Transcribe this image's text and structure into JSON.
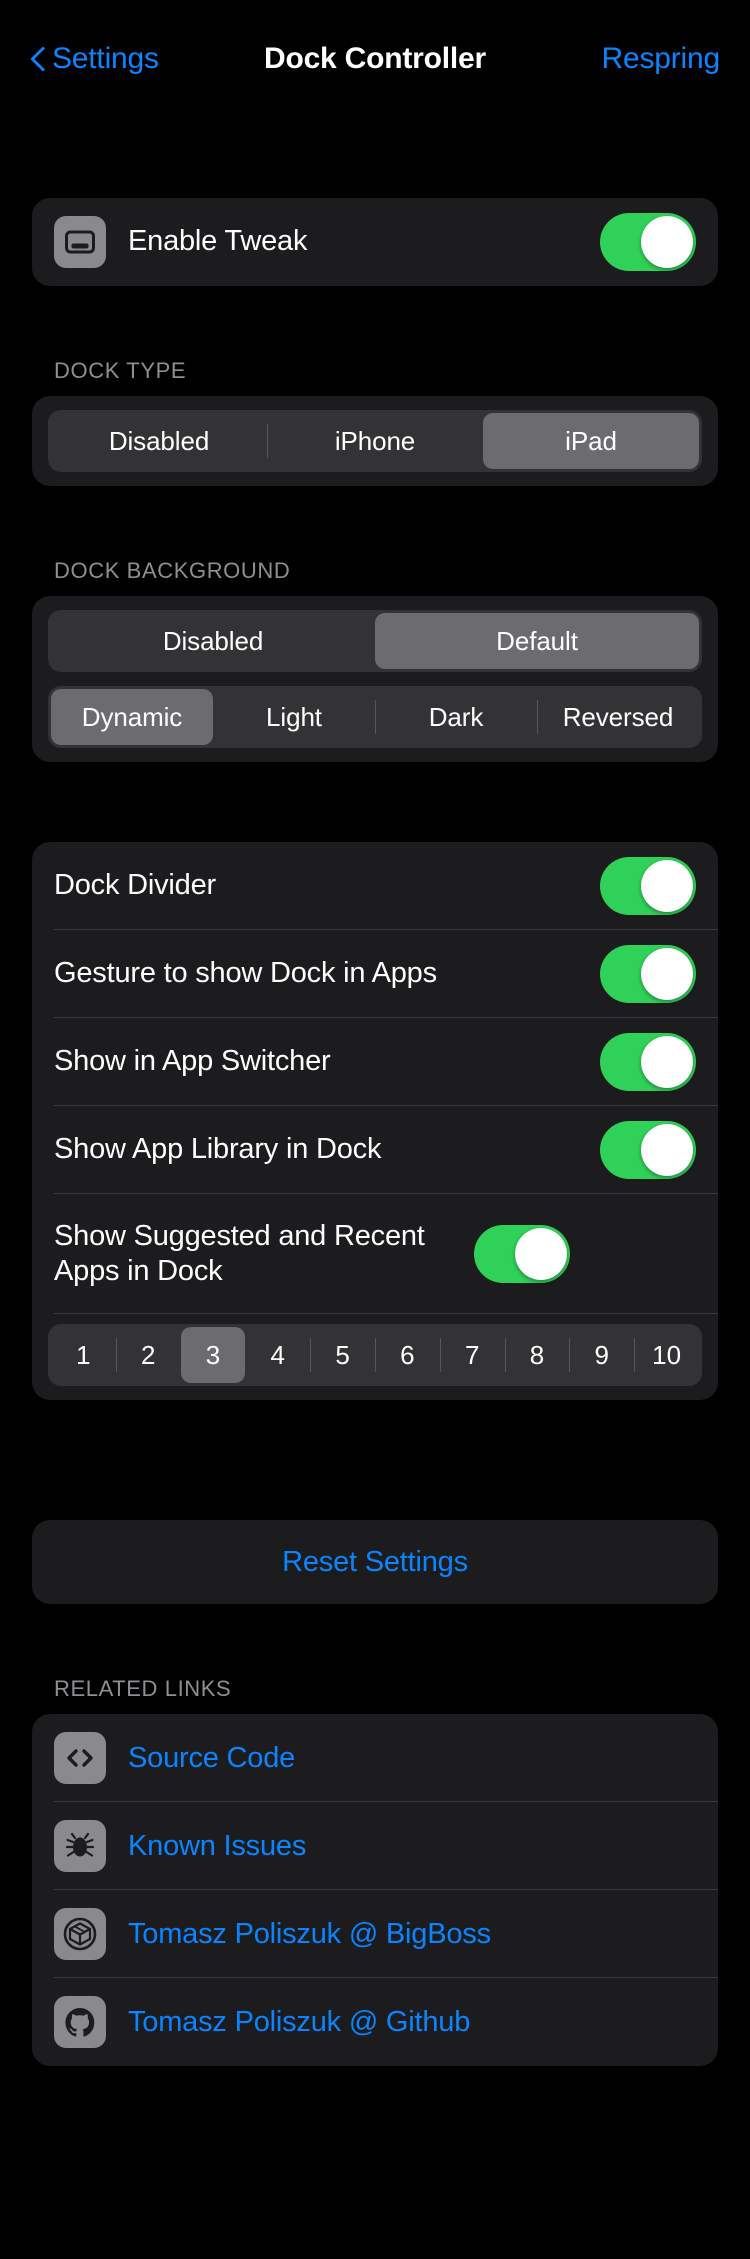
{
  "nav": {
    "back_label": "Settings",
    "back_icon": "chevron-left-icon",
    "title": "Dock Controller",
    "action_label": "Respring"
  },
  "enable_section": {
    "row": {
      "icon": "dock-display-icon",
      "label": "Enable Tweak",
      "toggle_on": true
    }
  },
  "dock_type": {
    "header": "DOCK TYPE",
    "options": [
      "Disabled",
      "iPhone",
      "iPad"
    ],
    "selected": "iPad"
  },
  "dock_background": {
    "header": "DOCK BACKGROUND",
    "mode_options": [
      "Disabled",
      "Default"
    ],
    "mode_selected": "Default",
    "style_options": [
      "Dynamic",
      "Light",
      "Dark",
      "Reversed"
    ],
    "style_selected": "Dynamic"
  },
  "options_section": {
    "rows": [
      {
        "label": "Dock Divider",
        "toggle_on": true
      },
      {
        "label": "Gesture to show Dock in Apps",
        "toggle_on": true
      },
      {
        "label": "Show in App Switcher",
        "toggle_on": true
      },
      {
        "label": "Show App Library in Dock",
        "toggle_on": true
      },
      {
        "label": "Show Suggested and Recent Apps in Dock",
        "toggle_on": true
      }
    ],
    "count_options": [
      "1",
      "2",
      "3",
      "4",
      "5",
      "6",
      "7",
      "8",
      "9",
      "10"
    ],
    "count_selected": "3"
  },
  "reset": {
    "label": "Reset Settings"
  },
  "related_links": {
    "header": "RELATED LINKS",
    "items": [
      {
        "icon": "code-brackets-icon",
        "label": "Source Code"
      },
      {
        "icon": "bug-icon",
        "label": "Known Issues"
      },
      {
        "icon": "cydia-package-icon",
        "label": "Tomasz Poliszuk @ BigBoss"
      },
      {
        "icon": "github-icon",
        "label": "Tomasz Poliszuk @ Github"
      }
    ]
  },
  "colors": {
    "accent_blue": "#0A84FF",
    "toggle_green": "#30D158",
    "card_bg": "#1C1C1E",
    "segment_track": "#333335",
    "segment_selected": "#6C6C70",
    "header_gray": "#8E8E93",
    "page_bg": "#000000"
  }
}
